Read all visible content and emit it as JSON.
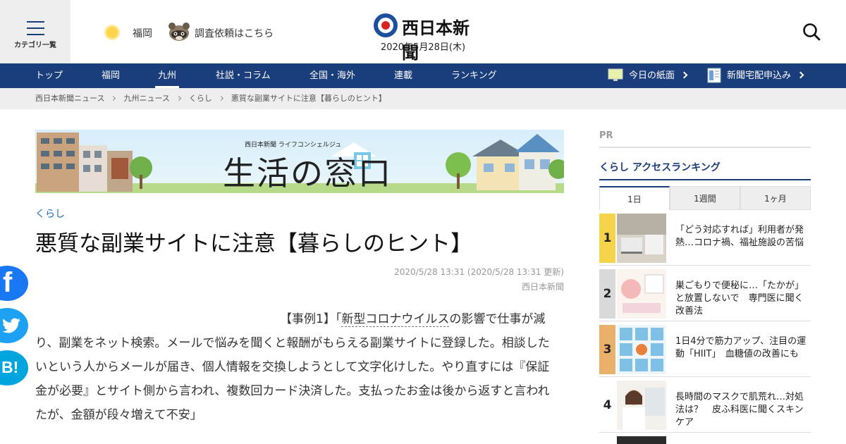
{
  "header": {
    "category_menu_label": "カテゴリ一覧",
    "weather_city": "福岡",
    "request_link": "調査依頼はこちら",
    "logo_text": "西日本新聞",
    "date": "2020年5月28日(木)"
  },
  "nav": {
    "items": [
      "トップ",
      "福岡",
      "九州",
      "社説・コラム",
      "全国・海外",
      "連載",
      "ランキング"
    ],
    "active": "九州",
    "today_paper": "今日の紙面",
    "subscribe": "新聞宅配申込み"
  },
  "breadcrumb": [
    "西日本新聞ニュース",
    "九州ニュース",
    "くらし",
    "悪質な副業サイトに注意【暮らしのヒント】"
  ],
  "banner": {
    "subtitle": "西日本新聞 ライフコンシェルジュ",
    "title": "生活の窓口"
  },
  "article": {
    "category": "くらし",
    "headline": "悪質な副業サイトに注意【暮らしのヒント】",
    "date": "2020/5/28 13:31 (2020/5/28 13:31 更新)",
    "source": "西日本新聞",
    "body_prefix": "【事例1】「",
    "body_link": "新型コロナウイルス",
    "body_rest": "の影響で仕事が減り、副業をネット検索。メールで悩みを聞くと報酬がもらえる副業サイトに登録した。相談したいという人からメールが届き、個人情報を交換しようとして文字化けした。やり直すには『保証金が必要』とサイト側から言われ、複数回カード決済した。支払ったお金は後から返すと言われたが、金額が段々増えて不安」"
  },
  "social": {
    "facebook": "f",
    "twitter": "t",
    "hatena": "B!"
  },
  "sidebar": {
    "pr_label": "PR",
    "ranking_title": "くらし アクセスランキング",
    "tabs": [
      "1日",
      "1週間",
      "1ヶ月"
    ],
    "active_tab": "1日",
    "items": [
      {
        "rank": "1",
        "title": "「どう対応すれば」利用者が発熱…コロナ禍、福祉施設の苦悩",
        "badge_color": "#f5d34a"
      },
      {
        "rank": "2",
        "title": "巣ごもりで便秘に…「たかが」と放置しないで　専門医に聞く改善法",
        "badge_color": "#d9d9d9"
      },
      {
        "rank": "3",
        "title": "1日4分で筋力アップ、注目の運動「HIIT」　血糖値の改善にも",
        "badge_color": "#e8b06a"
      },
      {
        "rank": "4",
        "title": "長時間のマスクで肌荒れ…対処法は？　皮ふ科医に聞くスキンケア",
        "badge_color": "#ffffff"
      }
    ]
  },
  "colors": {
    "brand_navy": "#1a3d7c",
    "logo_red": "#d8231f",
    "link_blue": "#1a6bbf",
    "facebook": "#1877f2",
    "twitter": "#1da1f2",
    "hatena": "#00a4de"
  }
}
